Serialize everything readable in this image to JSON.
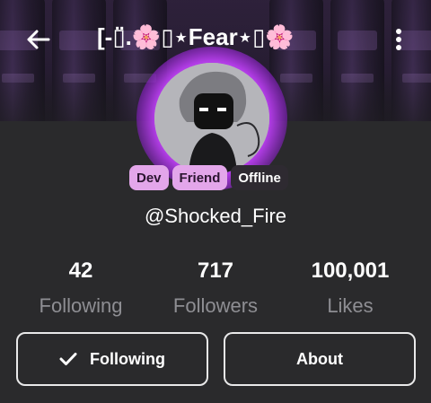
{
  "header": {
    "title": "[-▯̈.🌸▯⋆Fear⋆▯🌸"
  },
  "profile": {
    "badges": {
      "dev": "Dev",
      "friend": "Friend",
      "status": "Offline"
    },
    "username": "@Shocked_Fire"
  },
  "stats": {
    "following": {
      "value": "42",
      "label": "Following"
    },
    "followers": {
      "value": "717",
      "label": "Followers"
    },
    "likes": {
      "value": "100,001",
      "label": "Likes"
    }
  },
  "actions": {
    "following_label": "Following",
    "about_label": "About"
  },
  "icons": {
    "back": "back-arrow-icon",
    "menu": "more-vertical-icon",
    "check": "checkmark-icon"
  },
  "colors": {
    "background": "#2a2a2c",
    "badge_pink": "#e3a6ea",
    "muted_text": "#8e8e93",
    "avatar_glow": "#b23de6"
  }
}
